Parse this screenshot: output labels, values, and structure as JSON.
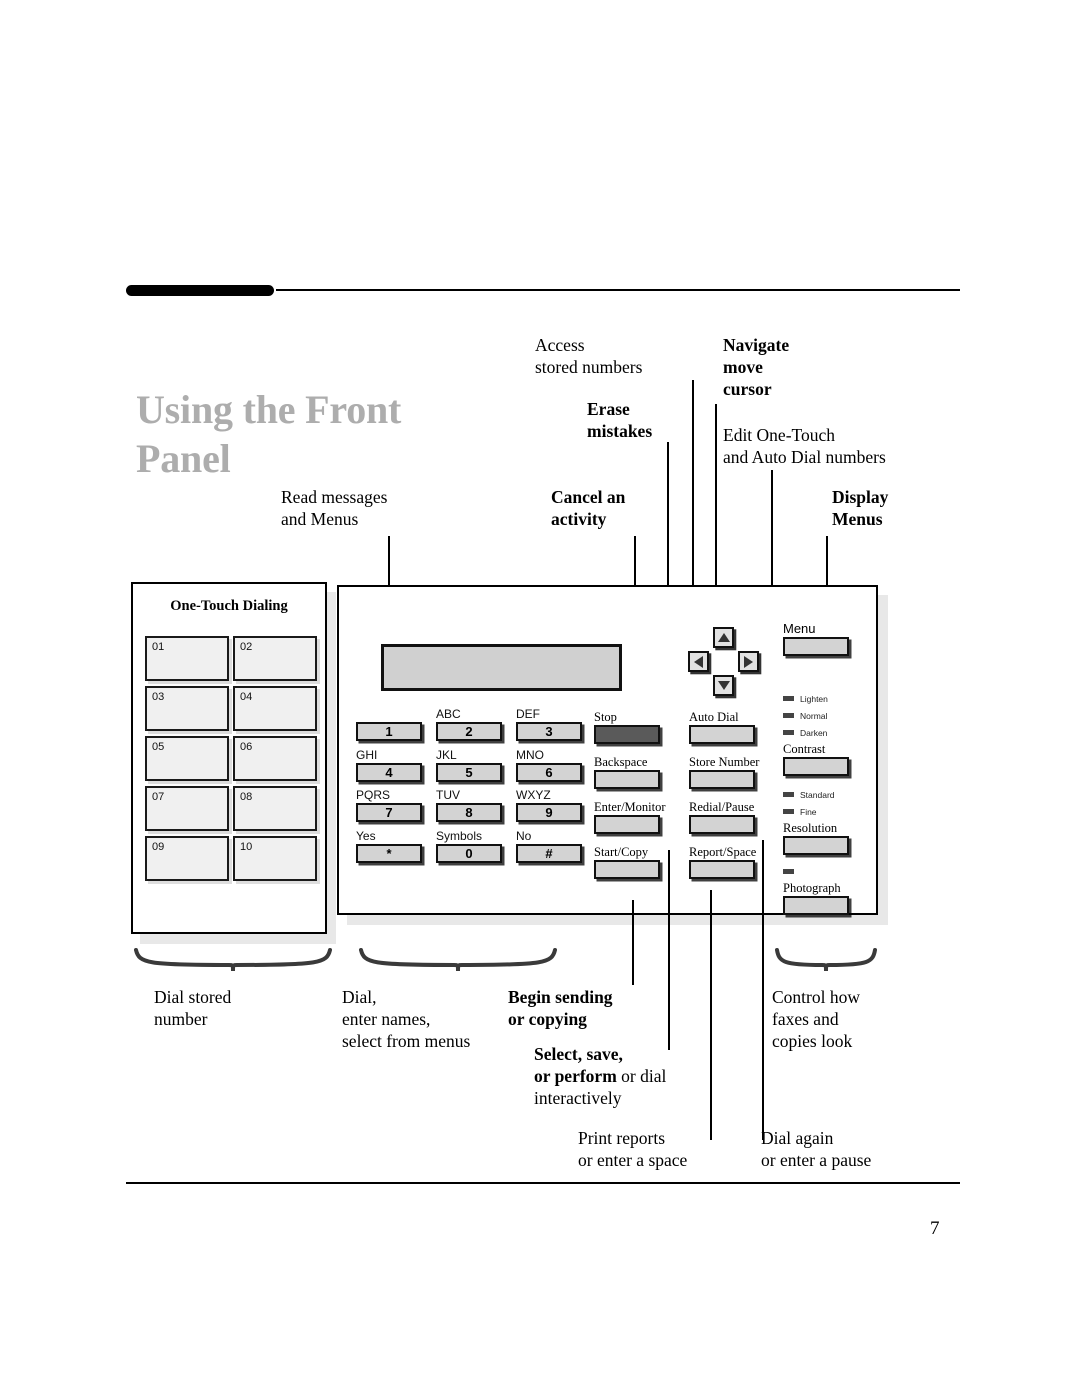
{
  "page": {
    "title_line1": "Using the Front",
    "title_line2": "Panel",
    "page_number": "7"
  },
  "callouts_top": {
    "access_stored": "Access\nstored numbers",
    "erase_mistakes": "Erase\nmistakes",
    "navigate": "Navigate\nmove\ncursor",
    "edit_one_touch": "Edit One-Touch\nand Auto Dial numbers",
    "read_messages": "Read messages\nand Menus",
    "cancel_activity": "Cancel an\nactivity",
    "display_menus": "Display\nMenus"
  },
  "callouts_bottom": {
    "dial_stored": "Dial stored\nnumber",
    "dial_enter": "Dial,\nenter names,\nselect from menus",
    "begin_sending": "Begin sending\nor copying",
    "select_save_bold": "Select, save,\nor perform",
    "select_save_rest": " or dial\ninteractively",
    "control_how": "Control how\nfaxes and\ncopies look",
    "print_reports": "Print reports\nor enter a space",
    "dial_again": "Dial again\nor enter a pause"
  },
  "one_touch": {
    "heading": "One-Touch Dialing",
    "keys": [
      "01",
      "02",
      "03",
      "04",
      "05",
      "06",
      "07",
      "08",
      "09",
      "10"
    ]
  },
  "keypad": {
    "rows": [
      [
        {
          "label": "",
          "digit": "1"
        },
        {
          "label": "ABC",
          "digit": "2"
        },
        {
          "label": "DEF",
          "digit": "3"
        }
      ],
      [
        {
          "label": "GHI",
          "digit": "4"
        },
        {
          "label": "JKL",
          "digit": "5"
        },
        {
          "label": "MNO",
          "digit": "6"
        }
      ],
      [
        {
          "label": "PQRS",
          "digit": "7"
        },
        {
          "label": "TUV",
          "digit": "8"
        },
        {
          "label": "WXYZ",
          "digit": "9"
        }
      ],
      [
        {
          "label": "Yes",
          "digit": "*"
        },
        {
          "label": "Symbols",
          "digit": "0"
        },
        {
          "label": "No",
          "digit": "#"
        }
      ]
    ]
  },
  "function_col1": {
    "items": [
      {
        "label": "Stop",
        "style": "dark"
      },
      {
        "label": "Backspace",
        "style": "light"
      },
      {
        "label": "Enter/Monitor",
        "style": "light"
      },
      {
        "label": "Start/Copy",
        "style": "light"
      }
    ]
  },
  "function_col2": {
    "items": [
      {
        "label": "Auto Dial",
        "style": "light"
      },
      {
        "label": "Store Number",
        "style": "light"
      },
      {
        "label": "Redial/Pause",
        "style": "light"
      },
      {
        "label": "Report/Space",
        "style": "light"
      }
    ]
  },
  "function_col3": {
    "menu_label": "Menu",
    "contrast_leds": [
      "Lighten",
      "Normal",
      "Darken"
    ],
    "contrast_label": "Contrast",
    "resolution_leds": [
      "Standard",
      "Fine"
    ],
    "resolution_label": "Resolution",
    "photograph_leds": [
      ""
    ],
    "photograph_label": "Photograph"
  },
  "arrow_pad": {
    "up": "arrow-up",
    "down": "arrow-down",
    "left": "arrow-left",
    "right": "arrow-right"
  },
  "colors": {
    "title_gray": "#adadad",
    "button_face": "#d3d3d3",
    "stop_button": "#5a5a5a",
    "lcd": "#d0d0d0",
    "panel_shadow": "#e8e8e8"
  }
}
